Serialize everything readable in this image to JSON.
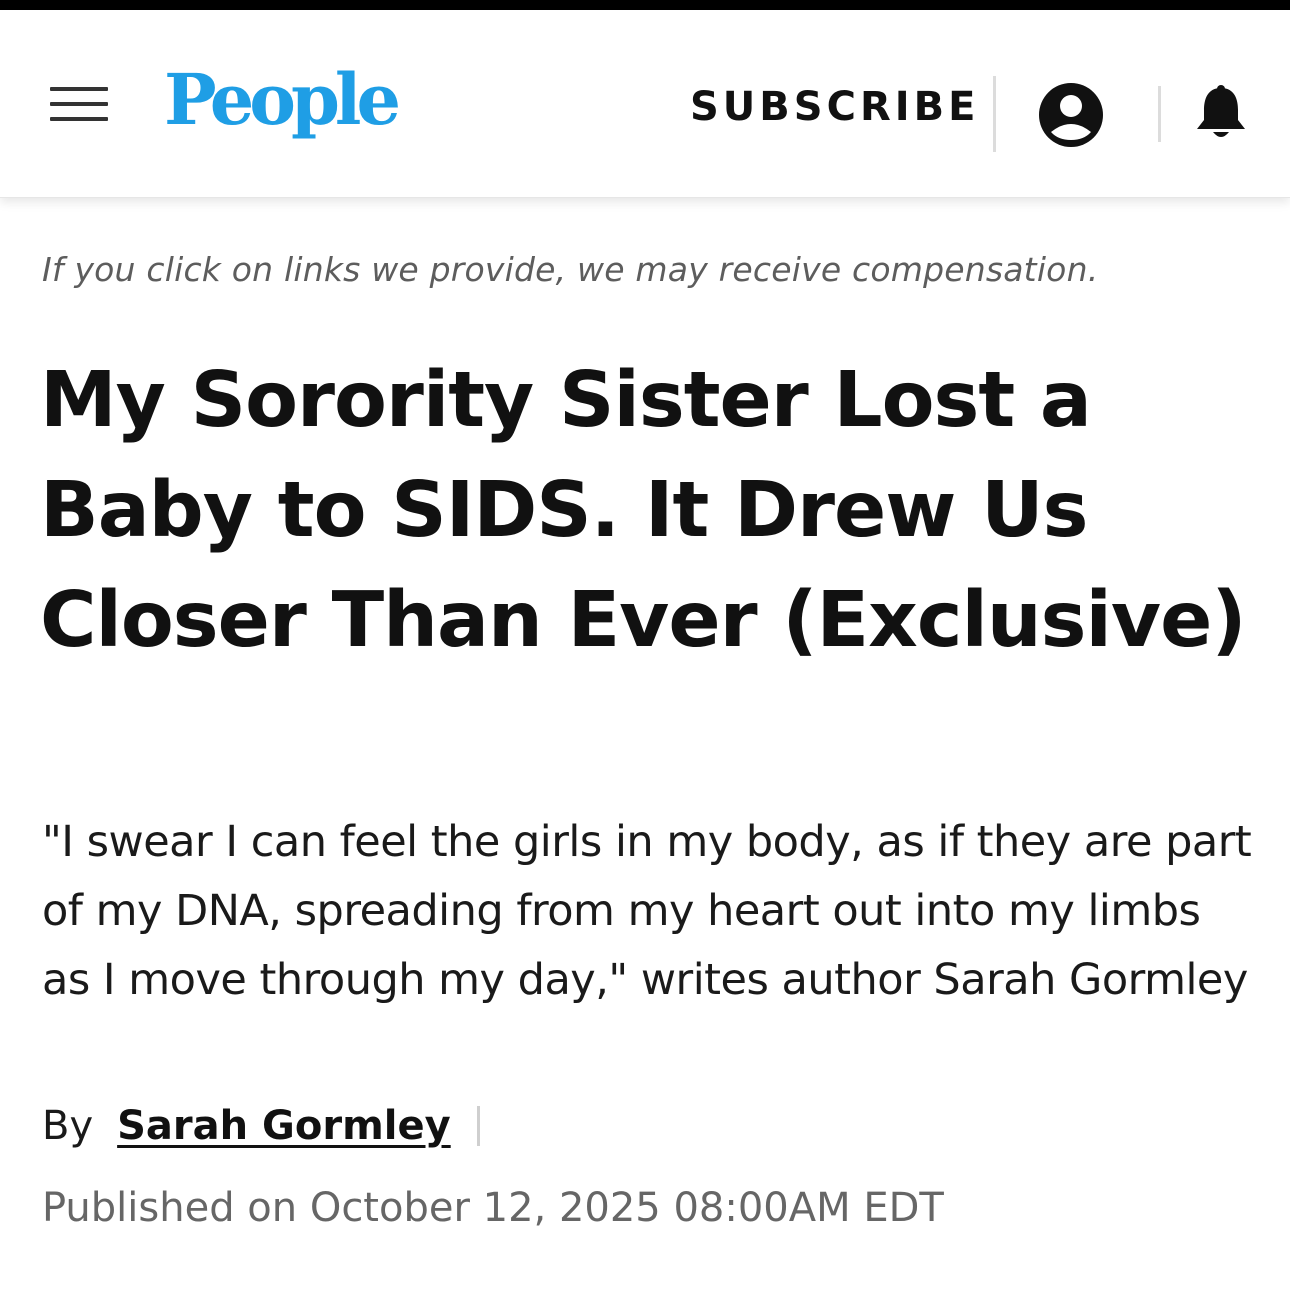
{
  "header": {
    "menu_icon": "hamburger-menu-icon",
    "logo_text": "People",
    "subscribe_label": "SUBSCRIBE",
    "account_icon": "account-icon",
    "notifications_icon": "bell-icon",
    "logo_color": "#1f9ee5"
  },
  "article": {
    "disclosure": "If you click on links we provide, we may receive compensation.",
    "headline": "My Sorority Sister Lost a Baby to SIDS. It Drew Us Closer Than Ever (Exclusive)",
    "dek": "\"I swear I can feel the girls in my body, as if they are part of my DNA, spreading from my heart out into my limbs as I move through my day,\" writes author Sarah Gormley",
    "byline": {
      "prefix": "By",
      "author": "Sarah Gormley"
    },
    "published": "Published on October 12, 2025 08:00AM EDT"
  }
}
